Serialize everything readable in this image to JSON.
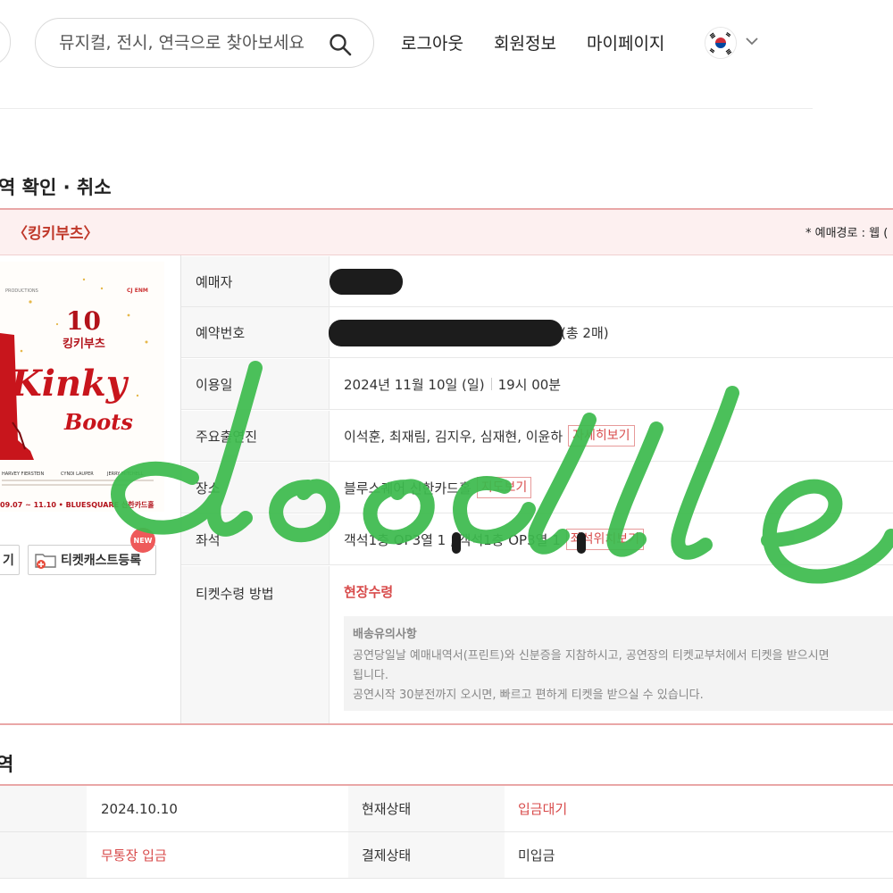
{
  "header": {
    "search": {
      "placeholder": "뮤지컬, 전시, 연극으로 찾아보세요",
      "icon": "search-icon"
    },
    "nav": [
      "로그아웃",
      "회원정보",
      "마이페이지"
    ],
    "language_flag": "korea-flag-icon"
  },
  "page": {
    "title": "역 확인 · 취소"
  },
  "booking": {
    "show_title": "〈킹키부츠〉",
    "route": "* 예매경로 : 웹 (",
    "poster": {
      "number": "10",
      "subtitle": "킹키부츠",
      "title_line1": "Kinky",
      "title_line2": "Boots",
      "credits": [
        "HARVEY FIERSTEIN",
        "CYNDI LAUPER",
        "JERRY MITCHELL"
      ],
      "dates": "09.07 ~ 11.10 • BLUESQUARE 신한카드홀",
      "brand": "CJ ENM"
    },
    "buttons": {
      "left_partial": "기",
      "ticketcast": "티켓캐스트등록",
      "new_badge": "NEW"
    },
    "rows": [
      {
        "label": "예매자",
        "value": ""
      },
      {
        "label": "예약번호",
        "value": "(총 2매)"
      },
      {
        "label": "이용일",
        "value": "2024년 11월 10일 (일)",
        "time": "19시 00분"
      },
      {
        "label": "주요출연진",
        "value": "이석훈, 최재림, 김지우, 심재현, 이윤하",
        "button": "자세히보기"
      },
      {
        "label": "장소",
        "value": "블루스퀘어 신한카드홀",
        "button": "지도보기"
      },
      {
        "label": "좌석",
        "value": "객석1층 OP3열 1 , 객석1층 OP3열 1",
        "button": "좌석위치보기"
      },
      {
        "label": "티켓수령 방법",
        "value": "현장수령"
      }
    ],
    "notice": {
      "title": "배송유의사항",
      "lines": [
        "공연당일날 예매내역서(프린트)와 신분증을 지참하시고, 공연장의 티켓교부처에서 티켓을 받으시면",
        "됩니다.",
        "공연시작 30분전까지 오시면, 빠르고 편하게 티켓을 받으실 수 있습니다."
      ]
    }
  },
  "payment": {
    "title": "역",
    "rows": [
      {
        "value": "2024.10.10",
        "label": "현재상태",
        "status": "입금대기"
      },
      {
        "value": "무통장 입금",
        "label": "결제상태",
        "status": "미입금"
      }
    ]
  },
  "overlay": {
    "text": "doodle",
    "color": "#3dbb4e"
  },
  "colors": {
    "accent_red": "#d84b4b",
    "panel_pink": "#fdf0f0",
    "border_pink": "#e9a7a7"
  }
}
